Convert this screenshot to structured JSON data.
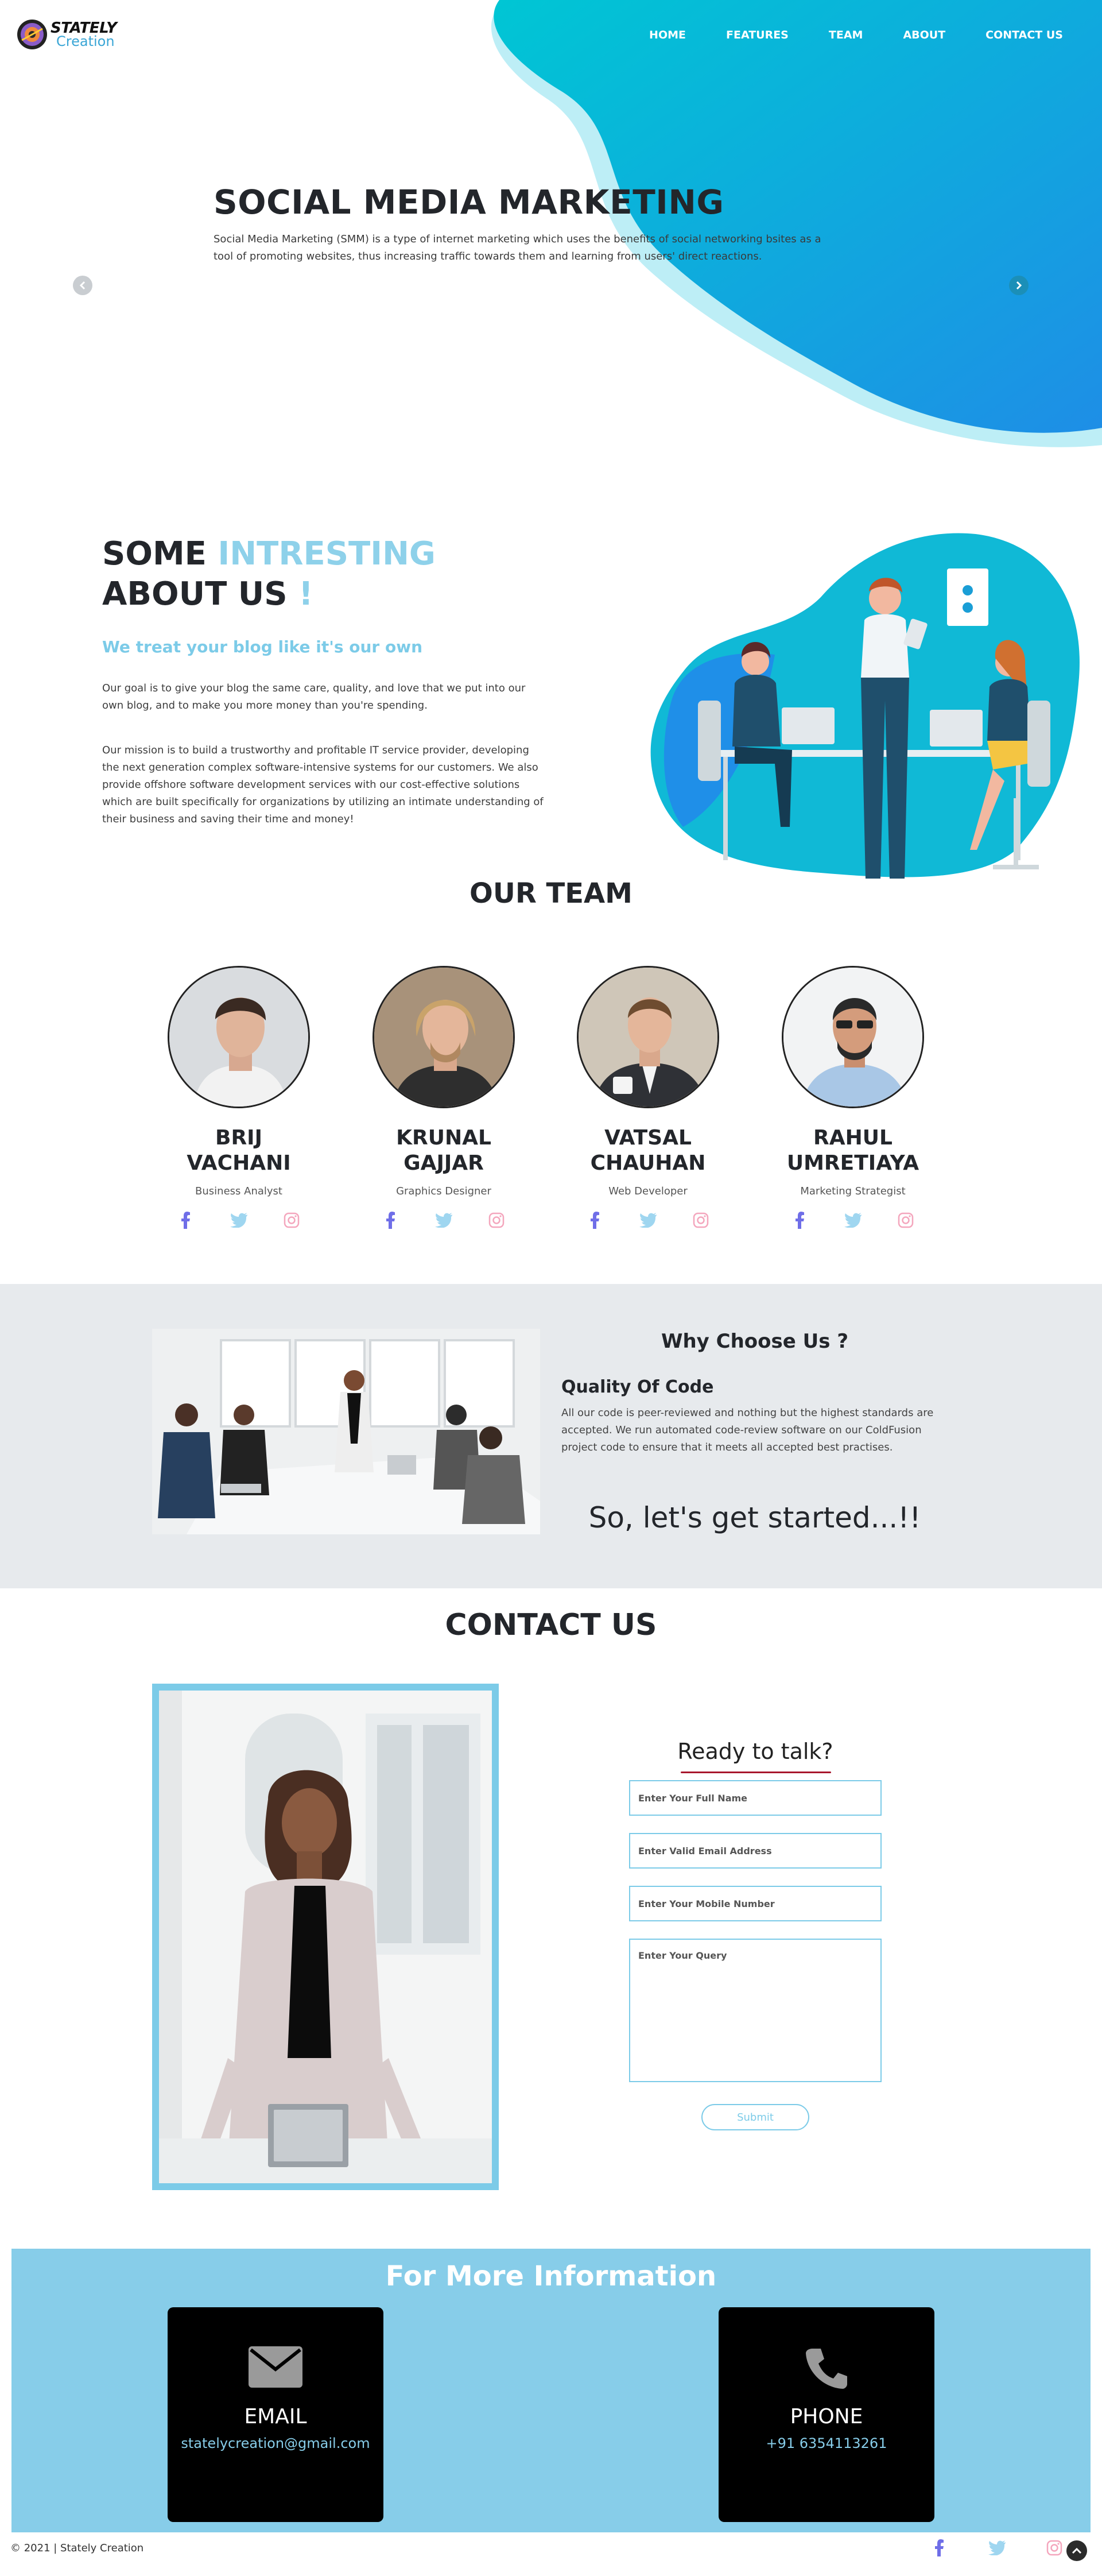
{
  "brand": {
    "name_top": "STATELY",
    "name_bottom": "Creation"
  },
  "nav": [
    "HOME",
    "FEATURES",
    "TEAM",
    "ABOUT",
    "CONTACT US"
  ],
  "hero": {
    "title": "SOCIAL MEDIA MARKETING",
    "text": "Social Media Marketing (SMM) is a type of internet marketing which uses the benefits of social networking bsites as a tool of promoting websites, thus increasing traffic towards them and learning from users' direct reactions.",
    "prev_icon": "chevron-left-icon",
    "next_icon": "chevron-right-icon"
  },
  "about": {
    "title_part1": "SOME ",
    "title_highlight": "INTRESTING",
    "title_part2": " ABOUT US ",
    "title_mark": "!",
    "subtitle": "We treat your blog like it's our own",
    "paragraph1": "Our goal is to give your blog the same care, quality, and love that we put into our own blog, and to make you more money than you're spending.",
    "paragraph2": "Our mission is to build a trustworthy and profitable IT service provider, developing the next generation complex software-intensive systems for our customers. We also provide offshore software development services with our cost-effective solutions which are built specifically for organizations by utilizing an intimate understanding of their business and saving their time and money!"
  },
  "team": {
    "title": "OUR TEAM",
    "members": [
      {
        "name": "BRIJ VACHANI",
        "role": "Business Analyst"
      },
      {
        "name": "KRUNAL GAJJAR",
        "role": "Graphics Designer"
      },
      {
        "name": "VATSAL CHAUHAN",
        "role": "Web Developer"
      },
      {
        "name": "RAHUL UMRETIAYA",
        "role": "Marketing Strategist"
      }
    ],
    "social_icons": [
      "facebook-icon",
      "twitter-icon",
      "instagram-icon"
    ]
  },
  "why": {
    "title": "Why Choose Us ?",
    "subtitle": "Quality Of Code",
    "text": "All our code is peer-reviewed and nothing but the highest standards are accepted. We run automated code-review software on our ColdFusion project code to ensure that it meets all accepted best practises.",
    "cta": "So, let's get started...!!"
  },
  "contact": {
    "title": "CONTACT US",
    "form_title": "Ready to talk?",
    "name_placeholder": "Enter Your Full Name",
    "email_placeholder": "Enter Valid Email Address",
    "mobile_placeholder": "Enter Your Mobile Number",
    "query_placeholder": "Enter Your Query",
    "submit_label": "Submit"
  },
  "info": {
    "title": "For More Information",
    "email_label": "EMAIL",
    "email_value": "statelycreation@gmail.com",
    "phone_label": "PHONE",
    "phone_value": "+91 6354113261"
  },
  "footer": {
    "copyright": "© 2021 | Stately Creation"
  },
  "colors": {
    "accent": "#7ccbe8",
    "hero_gradient_start": "#00c2d6",
    "hero_gradient_end": "#1e90e6",
    "dark_text": "#23262b",
    "why_bg": "#e7eaed",
    "info_bg": "#87cde9",
    "facebook": "#6f6ee8",
    "twitter": "#9fd6f0",
    "instagram": "#f4a6bd"
  }
}
